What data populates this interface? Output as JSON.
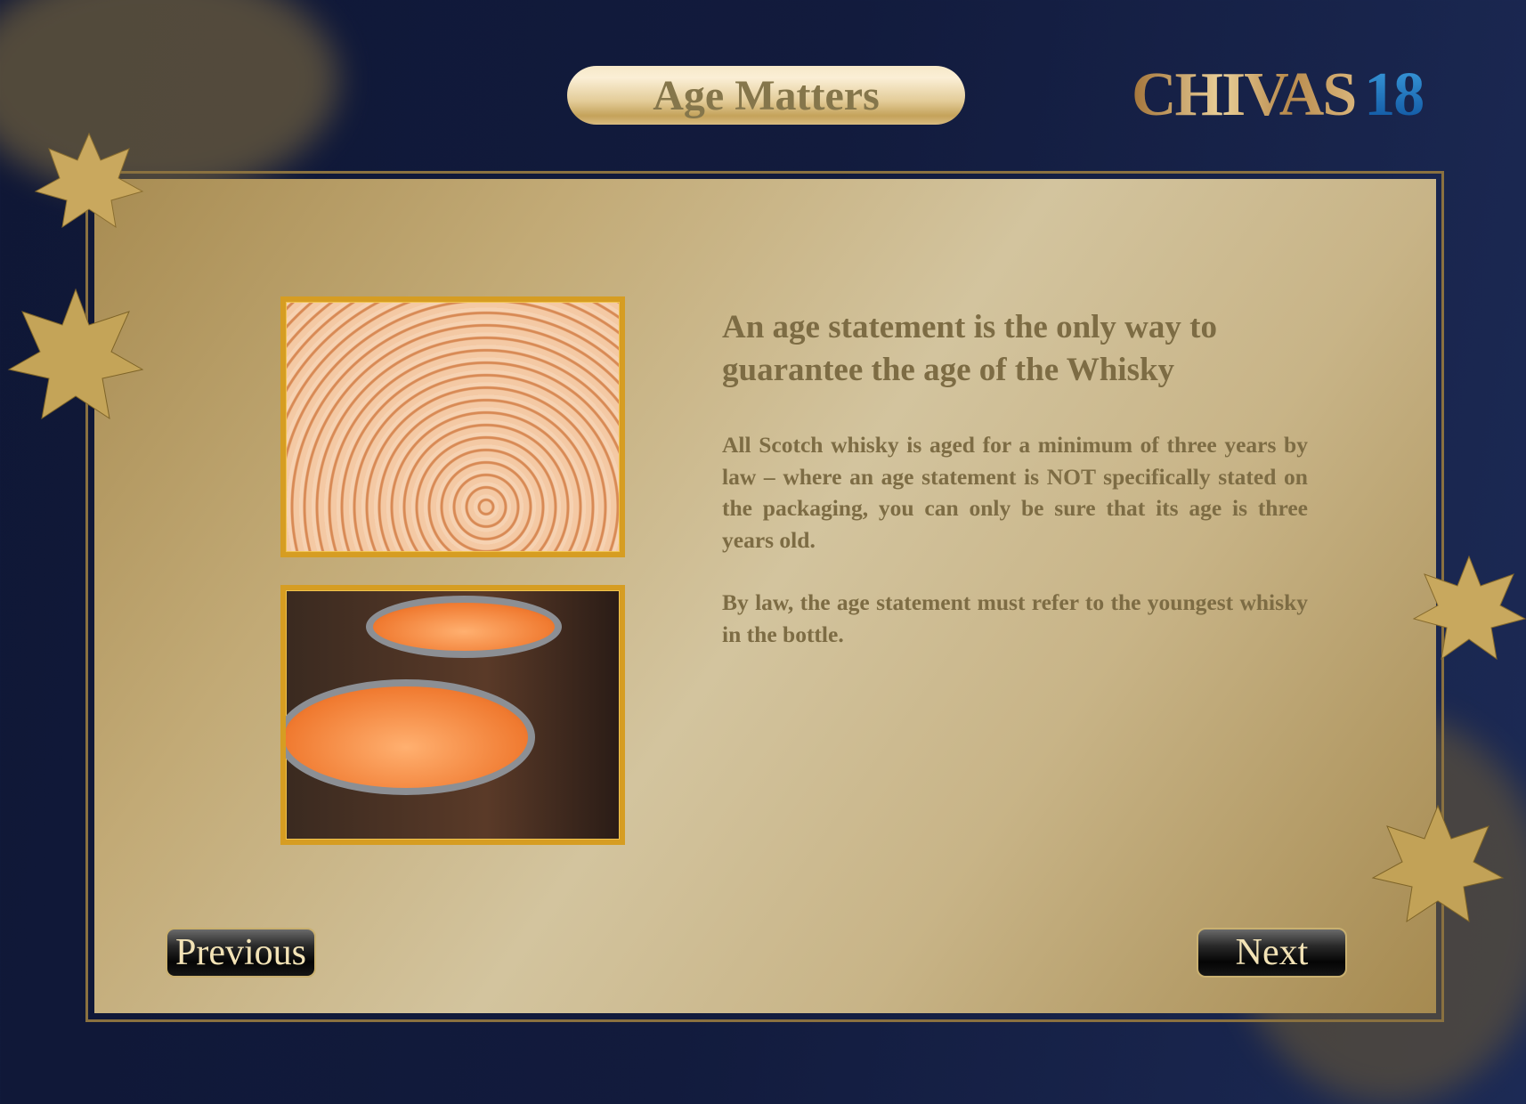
{
  "header": {
    "title": "Age Matters",
    "logo_brand": "CHIVAS",
    "logo_number": "18"
  },
  "content": {
    "heading": "An age statement is the only way to guarantee the age of the Whisky",
    "paragraphs": [
      "All Scotch whisky is aged for a minimum of three years by law – where an age statement is NOT specifically stated on the packaging, you can only be sure that its age is three years old.",
      "By law, the age statement must refer to the youngest whisky in the bottle."
    ]
  },
  "nav": {
    "previous_label": "Previous",
    "next_label": "Next"
  },
  "colors": {
    "background": "#121b3d",
    "gold": "#c4a25a",
    "text": "#7d6c44",
    "logo_blue": "#1a6fc0"
  }
}
